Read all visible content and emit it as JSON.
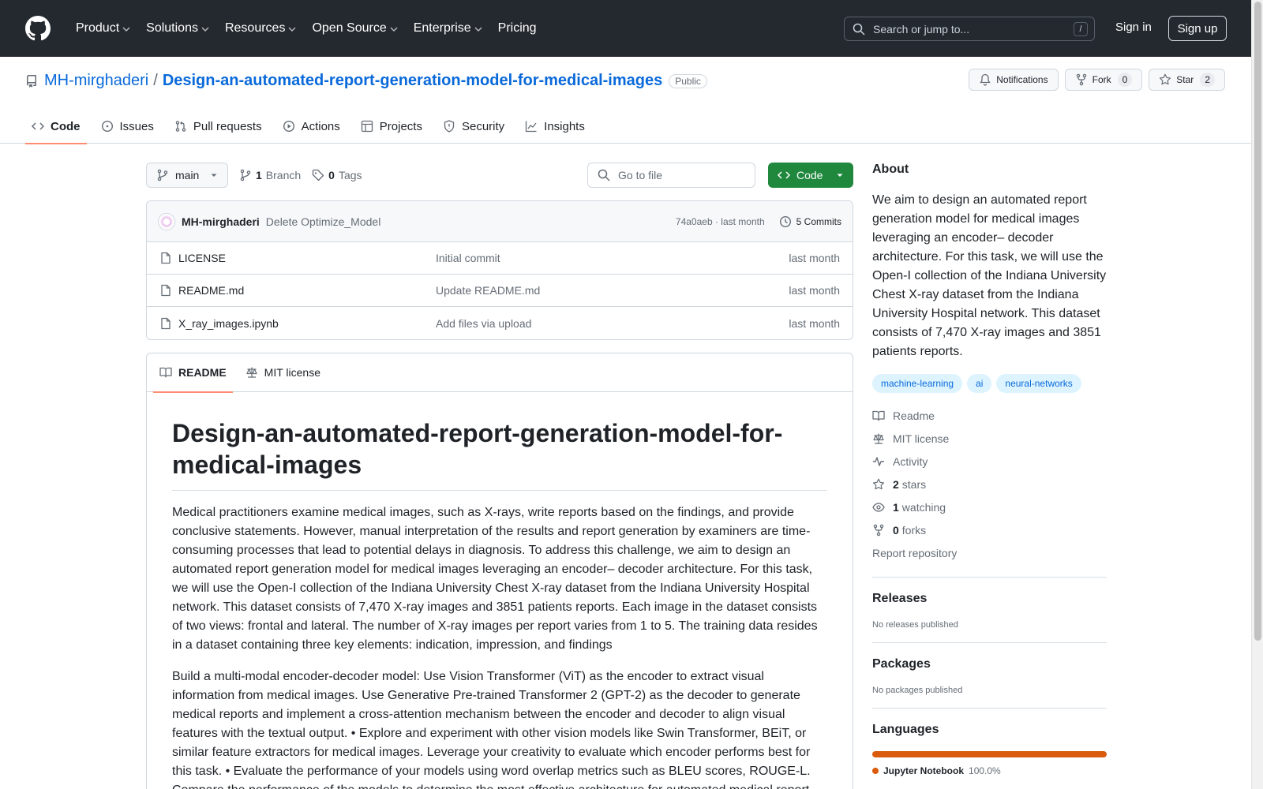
{
  "header": {
    "nav": [
      "Product",
      "Solutions",
      "Resources",
      "Open Source",
      "Enterprise",
      "Pricing"
    ],
    "search_placeholder": "Search or jump to...",
    "search_shortcut": "/",
    "signin": "Sign in",
    "signup": "Sign up"
  },
  "repo": {
    "owner": "MH-mirghaderi",
    "separator": "/",
    "name": "Design-an-automated-report-generation-model-for-medical-images",
    "visibility": "Public",
    "notifications": "Notifications",
    "fork_label": "Fork",
    "fork_count": "0",
    "star_label": "Star",
    "star_count": "2",
    "tabs": [
      "Code",
      "Issues",
      "Pull requests",
      "Actions",
      "Projects",
      "Security",
      "Insights"
    ]
  },
  "toolbar": {
    "branch": "main",
    "branch_count": "1",
    "branch_label": "Branch",
    "tag_count": "0",
    "tag_label": "Tags",
    "goto_placeholder": "Go to file",
    "code_button": "Code"
  },
  "commit": {
    "author": "MH-mirghaderi",
    "message": "Delete Optimize_Model",
    "sha_time": "74a0aeb · last month",
    "commits": "5 Commits"
  },
  "files": [
    {
      "name": "LICENSE",
      "message": "Initial commit",
      "date": "last month"
    },
    {
      "name": "README.md",
      "message": "Update README.md",
      "date": "last month"
    },
    {
      "name": "X_ray_images.ipynb",
      "message": "Add files via upload",
      "date": "last month"
    }
  ],
  "readme": {
    "tabs": [
      "README",
      "MIT license"
    ],
    "title": "Design-an-automated-report-generation-model-for-medical-images",
    "paragraphs": [
      "Medical practitioners examine medical images, such as X-rays, write reports based on the findings, and provide conclusive statements. However, manual interpretation of the results and report generation by examiners are time-consuming processes that lead to potential delays in diagnosis. To address this challenge, we aim to design an automated report generation model for medical images leveraging an encoder– decoder architecture. For this task, we will use the Open-I collection of the Indiana University Chest X-ray dataset from the Indiana University Hospital network. This dataset consists of 7,470 X-ray images and 3851 patients reports. Each image in the dataset consists of two views: frontal and lateral. The number of X-ray images per report varies from 1 to 5. The training data resides in a dataset containing three key elements: indication, impression, and findings",
      "Build a multi-modal encoder-decoder model: Use Vision Transformer (ViT) as the encoder to extract visual information from medical images. Use Generative Pre-trained Transformer 2 (GPT-2) as the decoder to generate medical reports and implement a cross-attention mechanism between the encoder and decoder to align visual features with the textual output. • Explore and experiment with other vision models like Swin Transformer, BEiT, or similar feature extractors for medical images. Leverage your creativity to evaluate which encoder performs best for this task. • Evaluate the performance of your models using word overlap metrics such as BLEU scores, ROUGE-L. Compare the performance of the models to determine the most effective architecture for automated medical report"
    ]
  },
  "about": {
    "title": "About",
    "description": "We aim to design an automated report generation model for medical images leveraging an encoder– decoder architecture. For this task, we will use the Open-I collection of the Indiana University Chest X-ray dataset from the Indiana University Hospital network. This dataset consists of 7,470 X-ray images and 3851 patients reports.",
    "topics": [
      "machine-learning",
      "ai",
      "neural-networks"
    ],
    "readme": "Readme",
    "license": "MIT license",
    "activity": "Activity",
    "stars_count": "2",
    "stars_label": "stars",
    "watching_count": "1",
    "watching_label": "watching",
    "forks_count": "0",
    "forks_label": "forks",
    "report": "Report repository"
  },
  "releases": {
    "title": "Releases",
    "empty": "No releases published"
  },
  "packages": {
    "title": "Packages",
    "empty": "No packages published"
  },
  "languages": {
    "title": "Languages",
    "items": [
      {
        "name": "Jupyter Notebook",
        "percent": "100.0%",
        "color": "#da5b0b"
      }
    ]
  },
  "colors": {
    "header_bg": "#24292f",
    "link": "#0969da",
    "code_button": "#1f883d",
    "tab_underline": "#fd8c73"
  }
}
